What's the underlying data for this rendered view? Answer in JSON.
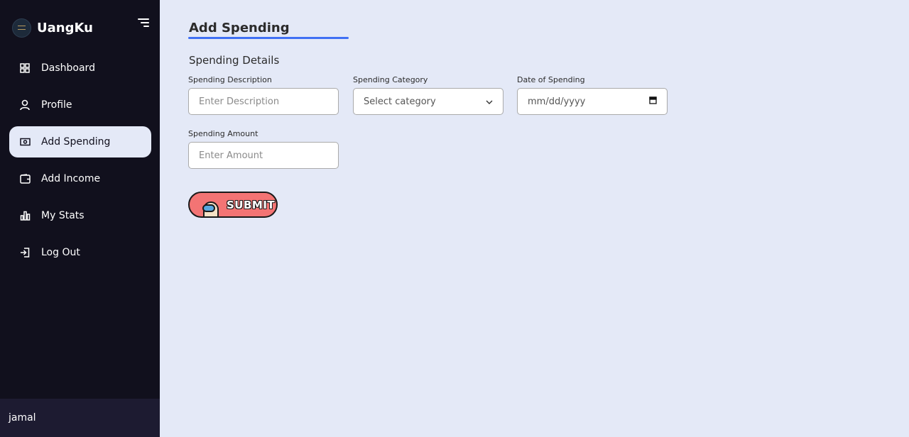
{
  "app": {
    "name": "UangKu"
  },
  "sidebar": {
    "items": [
      {
        "label": "Dashboard",
        "icon": "grid-icon",
        "active": false
      },
      {
        "label": "Profile",
        "icon": "user-icon",
        "active": false
      },
      {
        "label": "Add Spending",
        "icon": "money-icon",
        "active": true
      },
      {
        "label": "Add Income",
        "icon": "wallet-icon",
        "active": false
      },
      {
        "label": "My Stats",
        "icon": "bar-chart-icon",
        "active": false
      },
      {
        "label": "Log Out",
        "icon": "logout-icon",
        "active": false
      }
    ],
    "user": "jamal"
  },
  "main": {
    "title": "Add Spending",
    "section": "Spending Details",
    "fields": {
      "description": {
        "label": "Spending Description",
        "placeholder": "Enter Description"
      },
      "category": {
        "label": "Spending Category",
        "placeholder": "Select category"
      },
      "date": {
        "label": "Date of Spending",
        "placeholder": "mm/dd/yyyy"
      },
      "amount": {
        "label": "Spending Amount",
        "placeholder": "Enter Amount"
      }
    },
    "submit_label": "SUBMIT"
  },
  "colors": {
    "sidebar": "#11101d",
    "background": "#e4e9f7",
    "accent": "#4070f4",
    "submit": "#f37474"
  }
}
